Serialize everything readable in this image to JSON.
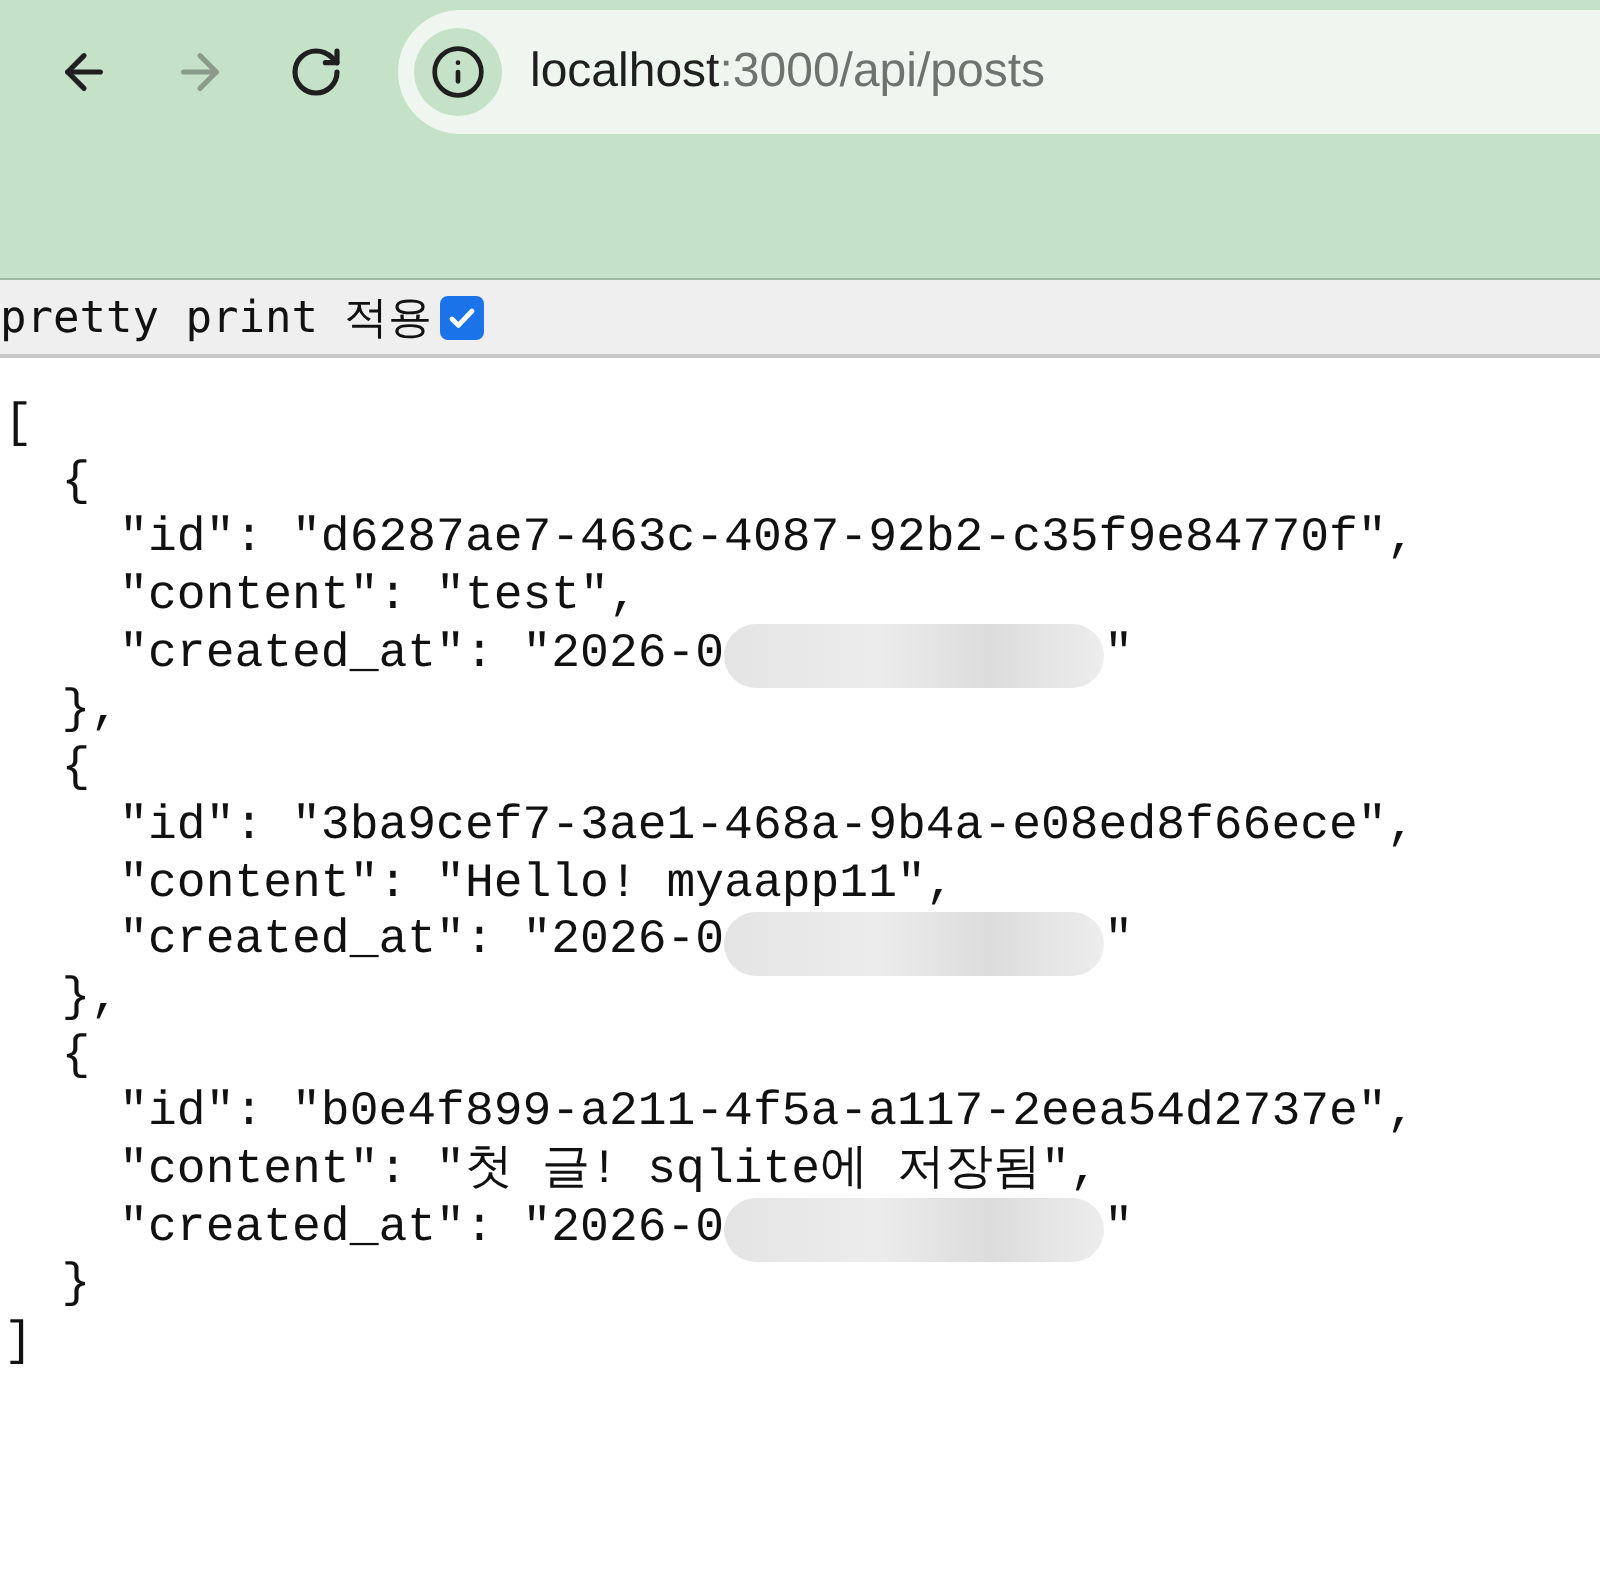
{
  "browser": {
    "nav_buttons": [
      {
        "kind": "back",
        "disabled": false
      },
      {
        "kind": "forward",
        "disabled": true
      },
      {
        "kind": "reload",
        "disabled": false
      }
    ],
    "address": {
      "host": "localhost",
      "path": ":3000/api/posts"
    }
  },
  "toolbar": {
    "label": "pretty print 적용",
    "checked": true
  },
  "json_lines": [
    {
      "text": "["
    },
    {
      "text": "  {"
    },
    {
      "text": "    \"id\": \"d6287ae7-463c-4087-92b2-c35f9e84770f\","
    },
    {
      "text": "    \"content\": \"test\","
    },
    {
      "text": "    \"created_at\": \"2026-0",
      "redacted": true,
      "suffix": "\""
    },
    {
      "text": "  },"
    },
    {
      "text": "  {"
    },
    {
      "text": "    \"id\": \"3ba9cef7-3ae1-468a-9b4a-e08ed8f66ece\","
    },
    {
      "text": "    \"content\": \"Hello! myaapp11\","
    },
    {
      "text": "    \"created_at\": \"2026-0",
      "redacted": true,
      "suffix": "\""
    },
    {
      "text": "  },"
    },
    {
      "text": "  {"
    },
    {
      "text": "    \"id\": \"b0e4f899-a211-4f5a-a117-2eea54d2737e\","
    },
    {
      "text": "    \"content\": \"첫 글! sqlite에 저장됨\","
    },
    {
      "text": "    \"created_at\": \"2026-0",
      "redacted": true,
      "suffix": "\""
    },
    {
      "text": "  }"
    },
    {
      "text": "]"
    }
  ]
}
